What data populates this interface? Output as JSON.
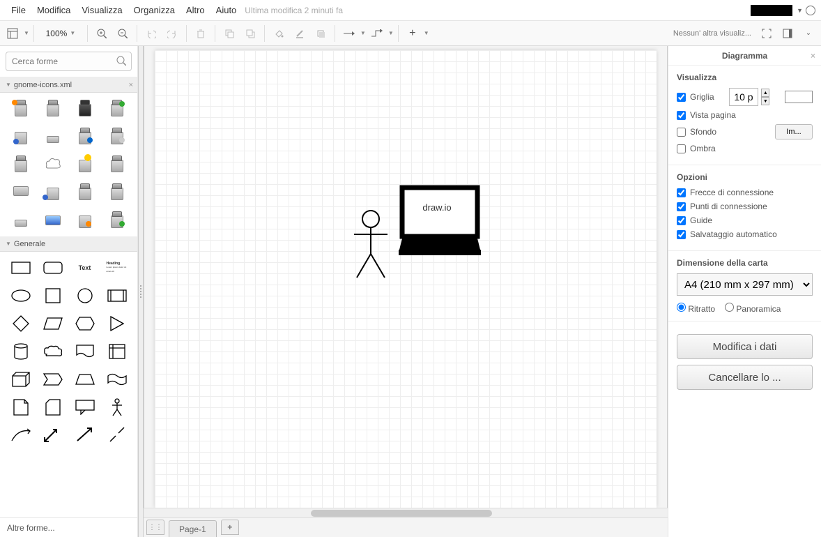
{
  "menu": {
    "items": [
      "File",
      "Modifica",
      "Visualizza",
      "Organizza",
      "Altro",
      "Aiuto"
    ],
    "last_modified": "Ultima modifica 2 minuti fa"
  },
  "toolbar": {
    "zoom": "100%",
    "format_text": "Nessun' altra visualiz..."
  },
  "sidebar": {
    "search_placeholder": "Cerca forme",
    "palettes": {
      "gnome": {
        "title": "gnome-icons.xml"
      },
      "general": {
        "title": "Generale",
        "text_label": "Text",
        "heading_label": "Heading"
      }
    },
    "more_shapes": "Altre forme..."
  },
  "canvas": {
    "pc_label": "draw.io",
    "page_tab": "Page-1"
  },
  "format": {
    "title": "Diagramma",
    "view": {
      "heading": "Visualizza",
      "grid": "Griglia",
      "grid_size": "10 p",
      "page_view": "Vista pagina",
      "background": "Sfondo",
      "background_btn": "Im...",
      "shadow": "Ombra"
    },
    "options": {
      "heading": "Opzioni",
      "conn_arrows": "Frecce di connessione",
      "conn_points": "Punti di connessione",
      "guides": "Guide",
      "autosave": "Salvataggio automatico"
    },
    "paper": {
      "heading": "Dimensione della carta",
      "size": "A4 (210 mm x 297 mm)",
      "portrait": "Ritratto",
      "landscape": "Panoramica"
    },
    "edit_data": "Modifica i dati",
    "clear_style": "Cancellare lo ..."
  }
}
